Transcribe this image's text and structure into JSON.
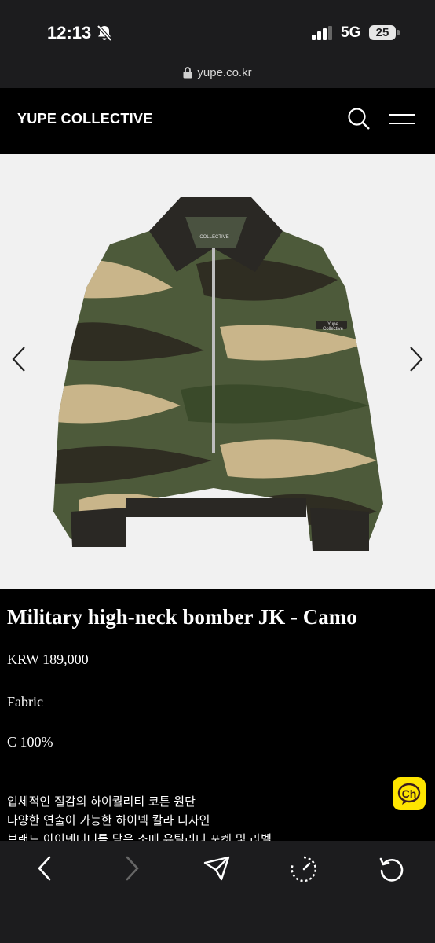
{
  "status_bar": {
    "time": "12:13",
    "network": "5G",
    "battery": "25"
  },
  "browser": {
    "url": "yupe.co.kr"
  },
  "site": {
    "logo": "YUPE COLLECTIVE"
  },
  "product": {
    "title": "Military high-neck bomber JK - Camo",
    "price": "KRW 189,000",
    "fabric_label": "Fabric",
    "fabric_value": "C 100%",
    "description": [
      "입체적인 질감의 하이퀄리티 코튼 원단",
      "다양한 연출이 가능한 하이넥 칼라 디자인",
      "브랜드 아이덴티티를 담은 소매 유틸리티 포켓 및 라벨"
    ],
    "collar_label": "COLLECTIVE",
    "sleeve_label": "Yupe Collective"
  },
  "chat": {
    "label": "Ch",
    "color": "#fee500"
  },
  "icons": {
    "mute": "bell-slash-icon",
    "lock": "lock-icon",
    "search": "search-icon",
    "menu": "hamburger-menu-icon",
    "prev_image": "chevron-left-icon",
    "next_image": "chevron-right-icon",
    "back": "back-icon",
    "forward": "forward-icon",
    "share": "send-icon",
    "timer": "timer-icon",
    "reload": "reload-icon"
  },
  "colors": {
    "background": "#000000",
    "browser_chrome": "#1c1c1e",
    "hero_bg": "#f1f1f1"
  }
}
